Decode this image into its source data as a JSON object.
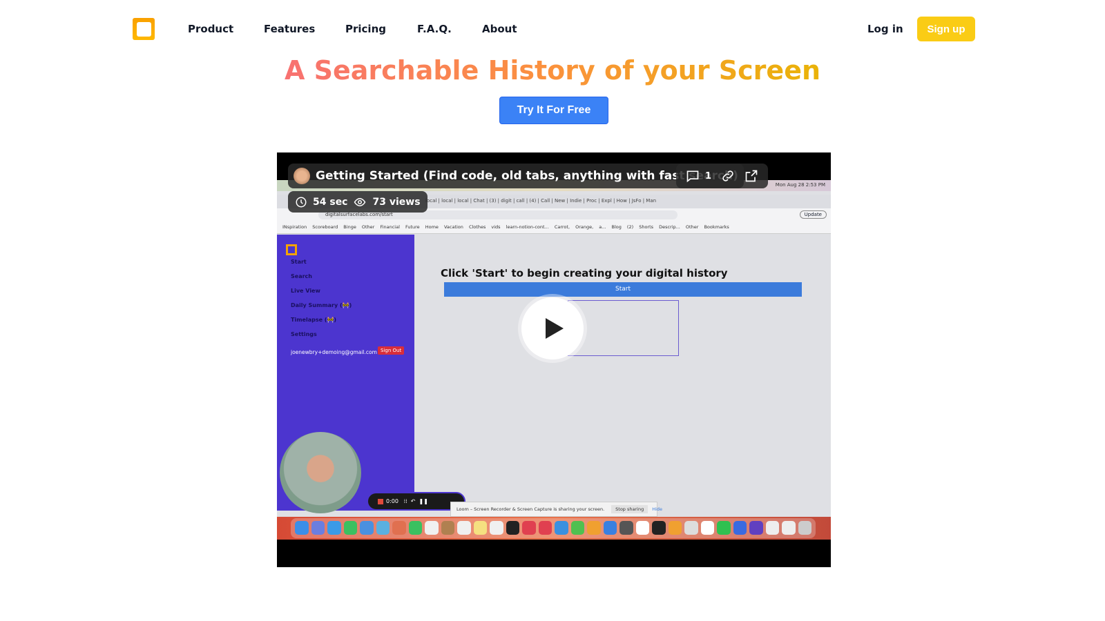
{
  "nav": {
    "logo": "app-logo",
    "links": [
      "Product",
      "Features",
      "Pricing",
      "F.A.Q.",
      "About"
    ],
    "login": "Log in",
    "signup": "Sign up"
  },
  "hero": {
    "title": "A Searchable History of your Screen",
    "cta": "Try It For Free"
  },
  "video": {
    "title": "Getting Started (Find code, old tabs, anything with fast search)",
    "comments": "1",
    "duration": "54 sec",
    "views": "73 views",
    "screen": {
      "menubar_clock": "Mon Aug 28  2:53 PM",
      "tabs": "local | local | local | Chat | (3) | digit | call | (4) | Call | New | Indie | Proc | Expl | How | JsFo | Man",
      "url": "digitalsurfacelabs.com/start",
      "update": "Update",
      "bookmarks": "INspiration  Scoreboard  Binge  Other  Financial  Future Home  Vacation  Clothes  vids  learn-notion-cont...  Carrot, Orange, a...  Blog  (2) Shorts Descrip...  Other Bookmarks",
      "sidebar": [
        "Start",
        "Search",
        "Live View",
        "Daily Summary (🚧)",
        "Timelapse (🚧)",
        "Settings"
      ],
      "email": "joenewbry+demoing@gmail.com",
      "signout": "Sign Out",
      "heading": "Click 'Start' to begin creating your digital history",
      "start": "Start",
      "rec_time": "0:00",
      "loom_msg": "Loom – Screen Recorder & Screen Capture is sharing your screen.",
      "stop_sharing": "Stop sharing",
      "hide": "Hide"
    }
  },
  "colors": {
    "accent": "#3b82f6",
    "signup": "#facc15",
    "logo": "#f9a000",
    "sidebar": "#4c35cf"
  }
}
